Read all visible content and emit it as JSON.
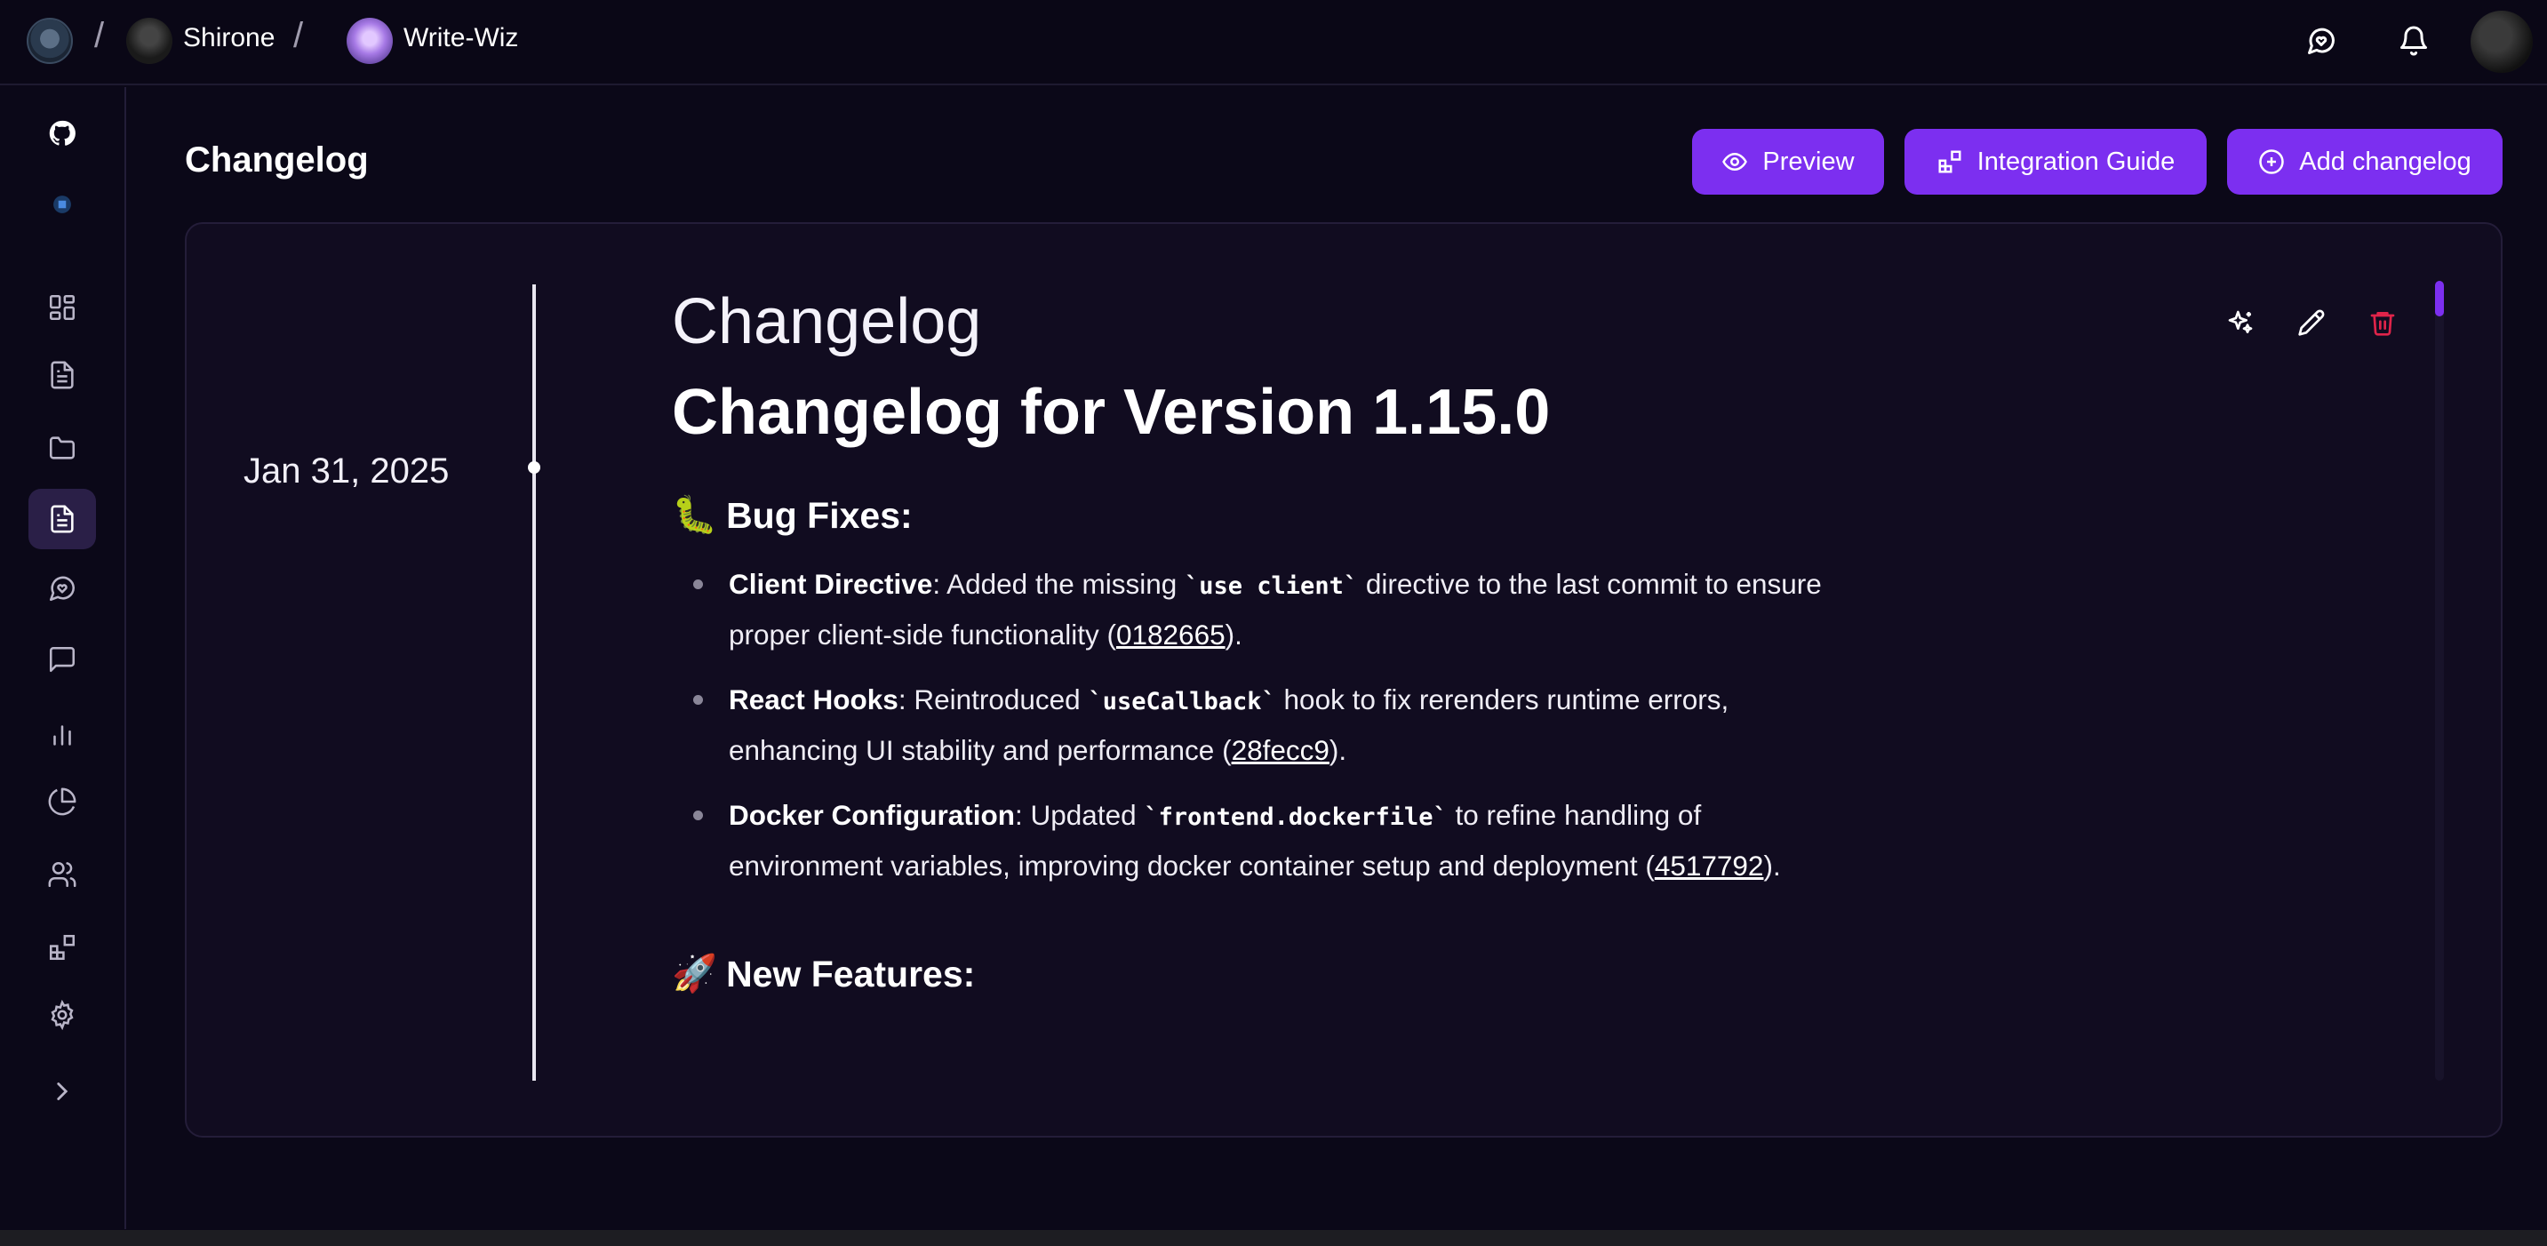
{
  "topbar": {
    "breadcrumb": [
      {
        "label": "Shirone"
      },
      {
        "label": "Write-Wiz"
      }
    ],
    "separator": "/",
    "icons": [
      "feedback-icon",
      "bell-icon",
      "user-avatar"
    ]
  },
  "sidebar": {
    "items": [
      {
        "name": "github-icon"
      },
      {
        "name": "project-logo-icon"
      },
      {
        "name": "dashboard-grid-icon"
      },
      {
        "name": "document-icon"
      },
      {
        "name": "folder-icon"
      },
      {
        "name": "changelog-document-icon",
        "active": true
      },
      {
        "name": "feedback-icon"
      },
      {
        "name": "chat-icon"
      },
      {
        "name": "bar-chart-icon"
      },
      {
        "name": "pie-chart-icon"
      },
      {
        "name": "users-icon"
      },
      {
        "name": "integrations-icon"
      },
      {
        "name": "settings-icon"
      },
      {
        "name": "expand-chevron-icon"
      }
    ]
  },
  "page": {
    "title": "Changelog",
    "buttons": {
      "preview": "Preview",
      "integration_guide": "Integration Guide",
      "add_changelog": "Add changelog"
    }
  },
  "entry": {
    "date": "Jan 31, 2025",
    "heading": "Changelog",
    "version_title": "Changelog for Version 1.15.0",
    "bug_fixes": {
      "emoji": "🐛",
      "title": "Bug Fixes:",
      "items": [
        {
          "strong": "Client Directive",
          "text_a": ": Added the missing ",
          "code": "`use client`",
          "text_b": " directive to the last commit to ensure proper client-side functionality (",
          "link": "0182665",
          "text_c": ")."
        },
        {
          "strong": "React Hooks",
          "text_a": ": Reintroduced ",
          "code": "`useCallback`",
          "text_b": " hook to fix rerenders runtime errors, enhancing UI stability and performance (",
          "link": "28fecc9",
          "text_c": ")."
        },
        {
          "strong": "Docker Configuration",
          "text_a": ": Updated ",
          "code": "`frontend.dockerfile`",
          "text_b": " to refine handling of environment variables, improving docker container setup and deployment (",
          "link": "4517792",
          "text_c": ")."
        }
      ]
    },
    "new_features": {
      "emoji": "🚀",
      "title": "New Features:"
    }
  },
  "colors": {
    "background": "#0b0818",
    "panel": "#110c20",
    "accent": "#7c2ff0",
    "delete": "#e0244a"
  }
}
